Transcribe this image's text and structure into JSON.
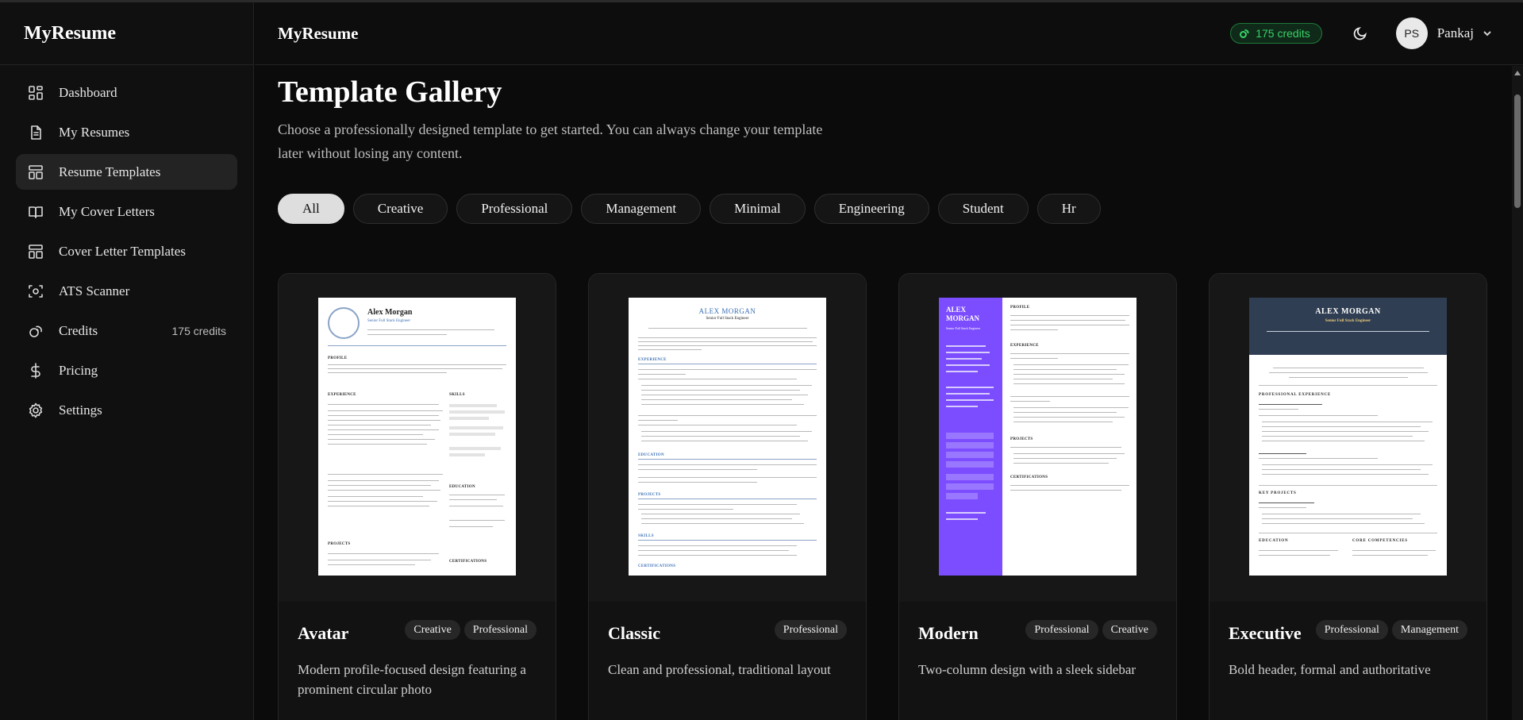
{
  "sidebar": {
    "brand": "MyResume",
    "items": [
      {
        "label": "Dashboard",
        "icon": "dashboard-icon"
      },
      {
        "label": "My Resumes",
        "icon": "document-icon"
      },
      {
        "label": "Resume Templates",
        "icon": "template-icon",
        "active": true
      },
      {
        "label": "My Cover Letters",
        "icon": "book-icon"
      },
      {
        "label": "Cover Letter Templates",
        "icon": "template-icon"
      },
      {
        "label": "ATS Scanner",
        "icon": "scan-icon"
      },
      {
        "label": "Credits",
        "icon": "coins-icon",
        "badge": "175 credits"
      },
      {
        "label": "Pricing",
        "icon": "dollar-icon"
      },
      {
        "label": "Settings",
        "icon": "gear-icon"
      }
    ]
  },
  "header": {
    "title": "MyResume",
    "credits": "175 credits",
    "user_initials": "PS",
    "user_name": "Pankaj"
  },
  "main": {
    "title": "Template Gallery",
    "subtitle": "Choose a professionally designed template to get started. You can always change your template later without losing any content.",
    "filters": [
      "All",
      "Creative",
      "Professional",
      "Management",
      "Minimal",
      "Engineering",
      "Student",
      "Hr"
    ],
    "active_filter": "All",
    "templates": [
      {
        "name": "Avatar",
        "tags": [
          "Creative",
          "Professional"
        ],
        "description": "Modern profile-focused design featuring a prominent circular photo"
      },
      {
        "name": "Classic",
        "tags": [
          "Professional"
        ],
        "description": "Clean and professional, traditional layout"
      },
      {
        "name": "Modern",
        "tags": [
          "Professional",
          "Creative"
        ],
        "description": "Two-column design with a sleek sidebar"
      },
      {
        "name": "Executive",
        "tags": [
          "Professional",
          "Management"
        ],
        "description": "Bold header, formal and authoritative"
      }
    ],
    "previews": {
      "person_name": "Alex Morgan",
      "person_name_upper": "ALEX MORGAN",
      "person_role": "Senior Full Stack Engineer",
      "modern_name_line1": "ALEX",
      "modern_name_line2": "MORGAN",
      "modern_role": "Senior Full Stack Engineer"
    }
  },
  "colors": {
    "accent_green": "#38d169",
    "modern_sidebar": "#7c4dff",
    "executive_header": "#2f3e52"
  }
}
